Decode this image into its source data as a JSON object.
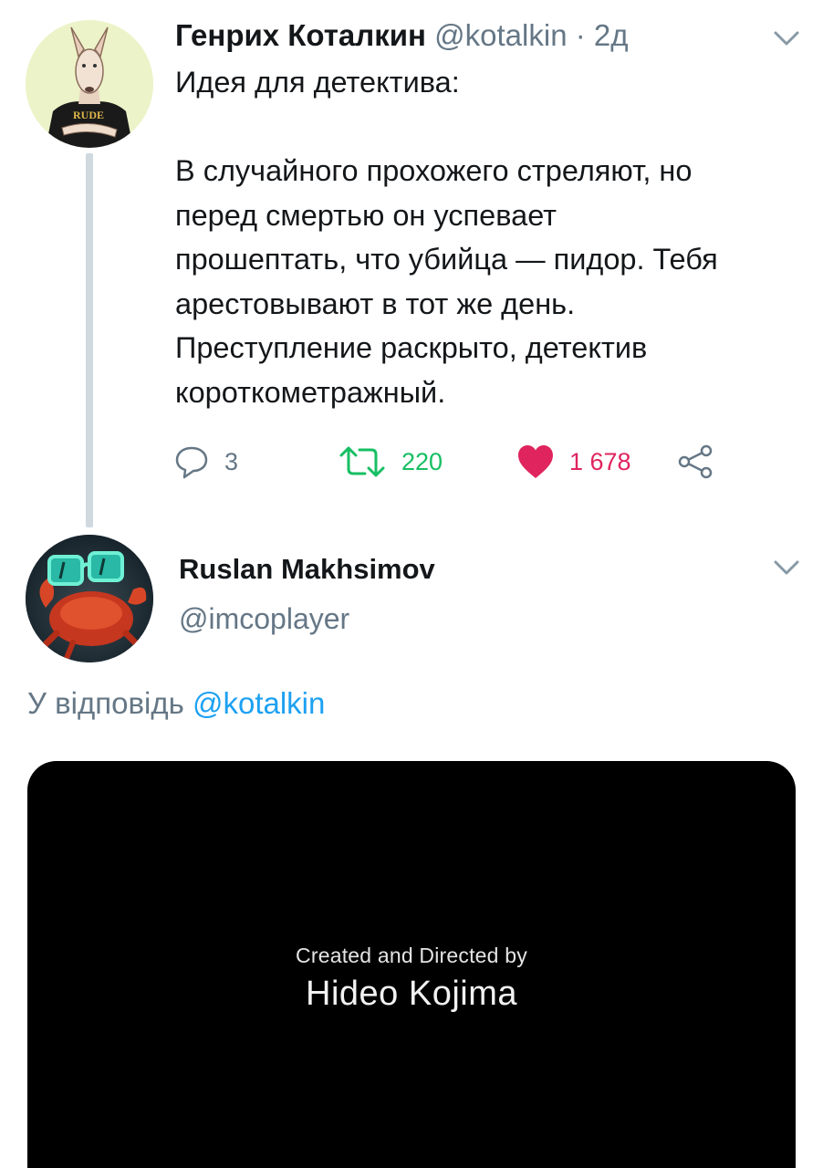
{
  "colors": {
    "text_primary": "#14171a",
    "text_secondary": "#657786",
    "link": "#1da1f2",
    "retweet": "#17bf63",
    "like": "#e0245e",
    "thread_line": "#cfd9df"
  },
  "tweet1": {
    "name": "Генрих Коталкин",
    "handle": "@kotalkin",
    "separator": "·",
    "time": "2д",
    "menu_icon": "chevron-down-icon",
    "lines": [
      "Идея для детектива:",
      "",
      "В случайного прохожего стреляют, но",
      "перед смертью он успевает",
      "прошептать, что убийца — пидор. Тебя",
      "арестовывают в тот же день.",
      "Преступление раскрыто, детектив",
      "короткометражный."
    ],
    "actions": {
      "reply_icon": "reply-icon",
      "reply_count": "3",
      "retweet_icon": "retweet-icon",
      "retweet_count": "220",
      "like_icon": "heart-icon",
      "like_count": "1 678",
      "share_icon": "share-icon"
    }
  },
  "tweet2": {
    "name": "Ruslan Makhsimov",
    "handle": "@imcoplayer",
    "menu_icon": "chevron-down-icon",
    "reply_prefix": "У відповідь",
    "reply_mention": "@kotalkin",
    "media": {
      "line1": "Created and Directed by",
      "line2": "Hideo Kojima"
    }
  }
}
